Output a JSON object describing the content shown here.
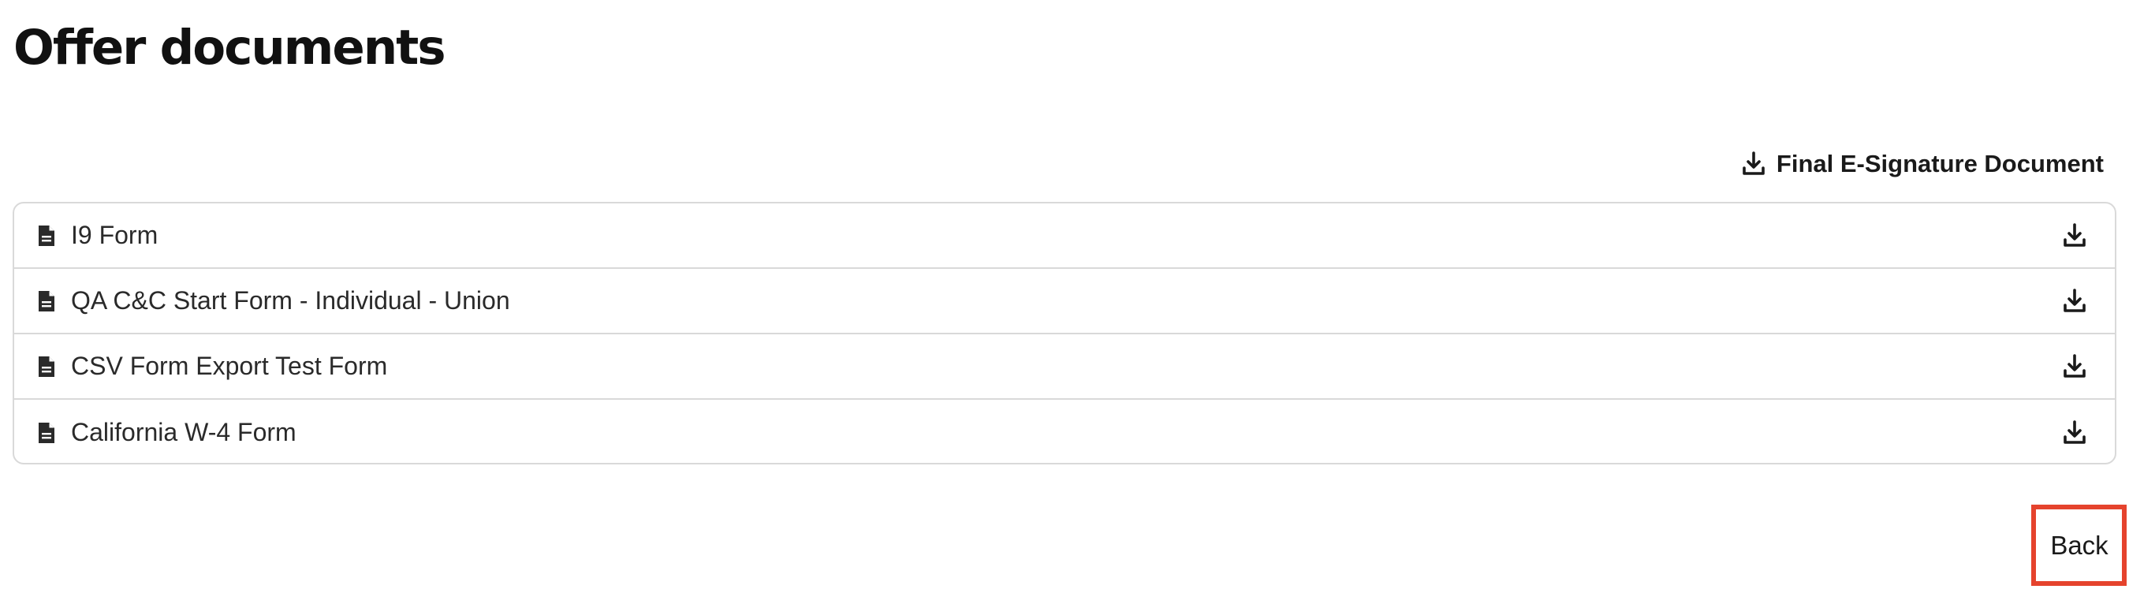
{
  "page": {
    "title": "Offer documents"
  },
  "final_document": {
    "label": "Final E-Signature Document",
    "icon": "download-icon"
  },
  "documents": [
    {
      "name": "I9 Form",
      "icon": "file-text-icon",
      "action_icon": "download-icon"
    },
    {
      "name": "QA C&C Start Form - Individual - Union",
      "icon": "file-text-icon",
      "action_icon": "download-icon"
    },
    {
      "name": "CSV Form Export Test Form",
      "icon": "file-text-icon",
      "action_icon": "download-icon"
    },
    {
      "name": "California W-4 Form",
      "icon": "file-text-icon",
      "action_icon": "download-icon"
    }
  ],
  "footer": {
    "back_label": "Back"
  },
  "colors": {
    "highlight": "#e5432d",
    "border": "#d9d9d9",
    "text": "#1f1f1f"
  }
}
